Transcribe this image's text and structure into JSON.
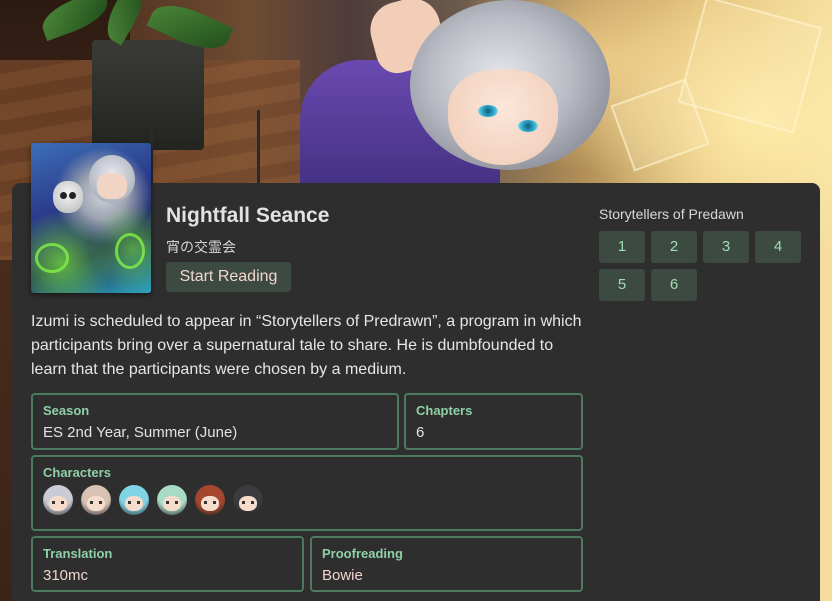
{
  "story": {
    "title": "Nightfall Seance",
    "subtitle_jp": "宵の交霊会",
    "start_button_label": "Start Reading",
    "description": "Izumi is scheduled to appear in “Storytellers of Predrawn”, a program in which participants bring over a supernatural tale to share. He is dumbfounded to learn that the participants were chosen by a medium."
  },
  "info": {
    "season_label": "Season",
    "season_value": "ES 2nd Year, Summer (June)",
    "chapters_label": "Chapters",
    "chapters_value": "6",
    "characters_label": "Characters",
    "characters": [
      {
        "icon": "silver-hair-avatar-icon",
        "color": "#c9ccd4"
      },
      {
        "icon": "beige-hair-avatar-icon",
        "color": "#d8c2b4"
      },
      {
        "icon": "cyan-hair-avatar-icon",
        "color": "#7fd4e6"
      },
      {
        "icon": "mint-hair-avatar-icon",
        "color": "#a9dcc6"
      },
      {
        "icon": "auburn-hair-avatar-icon",
        "color": "#a5472f"
      },
      {
        "icon": "dark-hair-avatar-icon",
        "color": "#3b3b40"
      }
    ],
    "translation_label": "Translation",
    "translation_value": "310mc",
    "proofreading_label": "Proofreading",
    "proofreading_value": "Bowie"
  },
  "arc": {
    "title": "Storytellers of Predawn",
    "chapters": [
      "1",
      "2",
      "3",
      "4",
      "5",
      "6"
    ]
  },
  "colors": {
    "panel": "#2e2e2e",
    "accent_border": "#4b7a5e",
    "accent_label": "#8fd0a8",
    "button_bg": "#3c4a41"
  }
}
